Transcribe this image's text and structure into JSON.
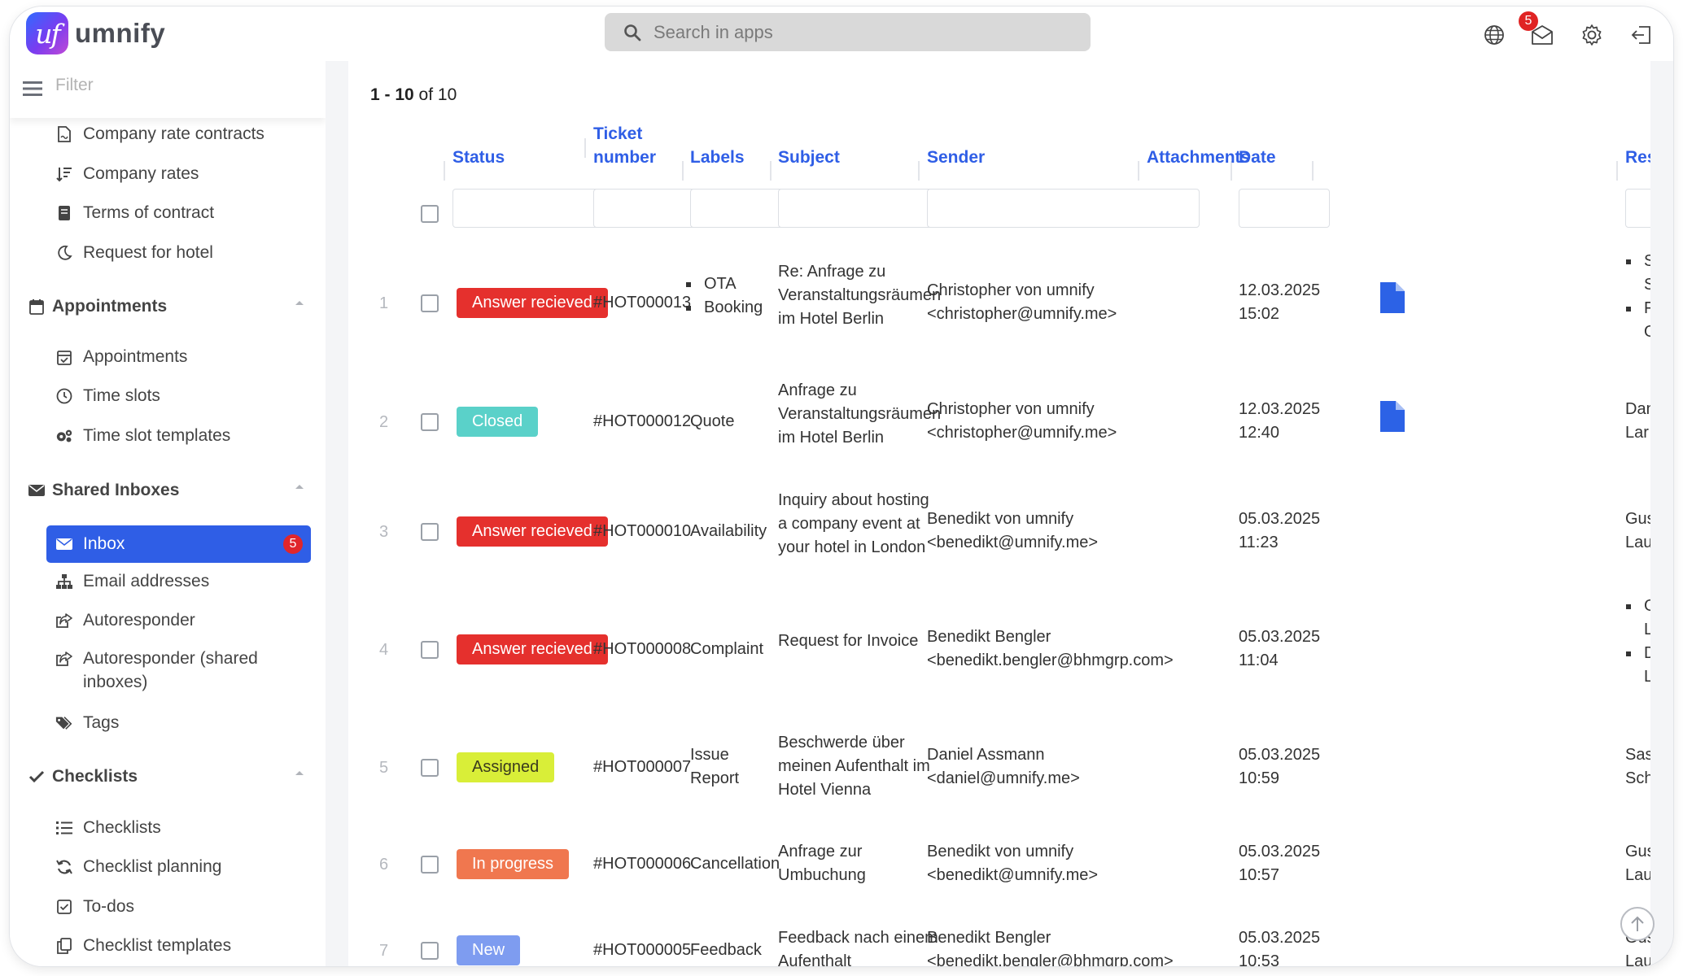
{
  "brand": {
    "logo_mark": "uf",
    "name": "umnify"
  },
  "search": {
    "placeholder": "Search in apps"
  },
  "top": {
    "mail_badge": "5"
  },
  "sidebar": {
    "filter_placeholder": "Filter",
    "items_top": [
      "Company rate contracts",
      "Company rates",
      "Terms of contract",
      "Request for hotel"
    ],
    "appointments": {
      "title": "Appointments",
      "items": [
        "Appointments",
        "Time slots",
        "Time slot templates"
      ]
    },
    "shared_inboxes": {
      "title": "Shared Inboxes",
      "active": {
        "label": "Inbox",
        "badge": "5"
      },
      "items": [
        "Email addresses",
        "Autoresponder",
        "Autoresponder (shared",
        "inboxes)",
        "Tags"
      ]
    },
    "checklists": {
      "title": "Checklists",
      "items": [
        "Checklists",
        "Checklist planning",
        "To-dos",
        "Checklist templates"
      ]
    }
  },
  "table": {
    "count_range": "1 - 10",
    "count_of": " of 10",
    "headers": {
      "status": "Status",
      "ticket_1": "Ticket",
      "ticket_2": "number",
      "labels": "Labels",
      "subject": "Subject",
      "sender": "Sender",
      "attachments": "Attachments",
      "date": "Date",
      "res": "Res"
    },
    "rows": [
      {
        "num": "1",
        "status": "Answer recieved",
        "ticket": "#HOT000013",
        "label_1": "OTA",
        "label_2": "Booking",
        "subject_1": "Re: Anfrage zu",
        "subject_2": "Veranstaltungsräumen",
        "subject_3": "im Hotel Berlin",
        "sender_1": "Christopher von umnify",
        "sender_2": "<christopher@umnify.me>",
        "date_1": "12.03.2025",
        "date_2": "15:02",
        "res_1": "S",
        "res_2": "S",
        "res_3": "Fı",
        "res_4": "O"
      },
      {
        "num": "2",
        "status": "Closed",
        "ticket": "#HOT000012",
        "label": "Quote",
        "subject_1": "Anfrage zu",
        "subject_2": "Veranstaltungsräumen",
        "subject_3": "im Hotel Berlin",
        "sender_1": "Christopher von umnify",
        "sender_2": "<christopher@umnify.me>",
        "date_1": "12.03.2025",
        "date_2": "12:40",
        "res_1": "Dan",
        "res_2": "Lar"
      },
      {
        "num": "3",
        "status": "Answer recieved",
        "ticket": "#HOT000010",
        "label": "Availability",
        "subject_1": "Inquiry about hosting",
        "subject_2": "a company event at",
        "subject_3": "your hotel in London",
        "sender_1": "Benedikt von umnify",
        "sender_2": "<benedikt@umnify.me>",
        "date_1": "05.03.2025",
        "date_2": "11:23",
        "res_1": "Gus",
        "res_2": "Lau"
      },
      {
        "num": "4",
        "status": "Answer recieved",
        "ticket": "#HOT000008",
        "label": "Complaint",
        "subject_1": "Request for Invoice",
        "sender_1": "Benedikt Bengler",
        "sender_2": "<benedikt.bengler@bhmgrp.com>",
        "date_1": "05.03.2025",
        "date_2": "11:04",
        "res_1": "G",
        "res_2": "Lı",
        "res_3": "D",
        "res_4": "Lı"
      },
      {
        "num": "5",
        "status": "Assigned",
        "ticket": "#HOT000007",
        "label_1": "Issue",
        "label_2": "Report",
        "subject_1": "Beschwerde über",
        "subject_2": "meinen Aufenthalt im",
        "subject_3": "Hotel Vienna",
        "sender_1": "Daniel Assmann",
        "sender_2": "<daniel@umnify.me>",
        "date_1": "05.03.2025",
        "date_2": "10:59",
        "res_1": "Sas",
        "res_2": "Sch"
      },
      {
        "num": "6",
        "status": "In progress",
        "ticket": "#HOT000006",
        "label": "Cancellation",
        "subject_1": "Anfrage zur",
        "subject_2": "Umbuchung",
        "sender_1": "Benedikt von umnify",
        "sender_2": "<benedikt@umnify.me>",
        "date_1": "05.03.2025",
        "date_2": "10:57",
        "res_1": "Gus",
        "res_2": "Lau"
      },
      {
        "num": "7",
        "status": "New",
        "ticket": "#HOT000005",
        "label": "Feedback",
        "subject_1": "Feedback nach einem",
        "subject_2": "Aufenthalt",
        "sender_1": "Benedikt Bengler",
        "sender_2": "<benedikt.bengler@bhmgrp.com>",
        "date_1": "05.03.2025",
        "date_2": "10:53",
        "res_1": "Gus",
        "res_2": "Lau"
      }
    ]
  },
  "colors": {
    "accent": "#2f5ee6",
    "answer_recieved": "#e5302d",
    "closed": "#5ad1c9",
    "assigned": "#d9ee38",
    "in_progress": "#f0774f",
    "new": "#7e9cf0",
    "attachment": "#2c62e6"
  },
  "icons": {
    "search": "search-icon",
    "globe": "globe-icon",
    "mail": "mail-icon",
    "settings": "gear-icon",
    "logout": "logout-icon",
    "menu": "hamburger-icon",
    "attachment": "document-icon",
    "scroll_top": "arrow-up-icon"
  }
}
